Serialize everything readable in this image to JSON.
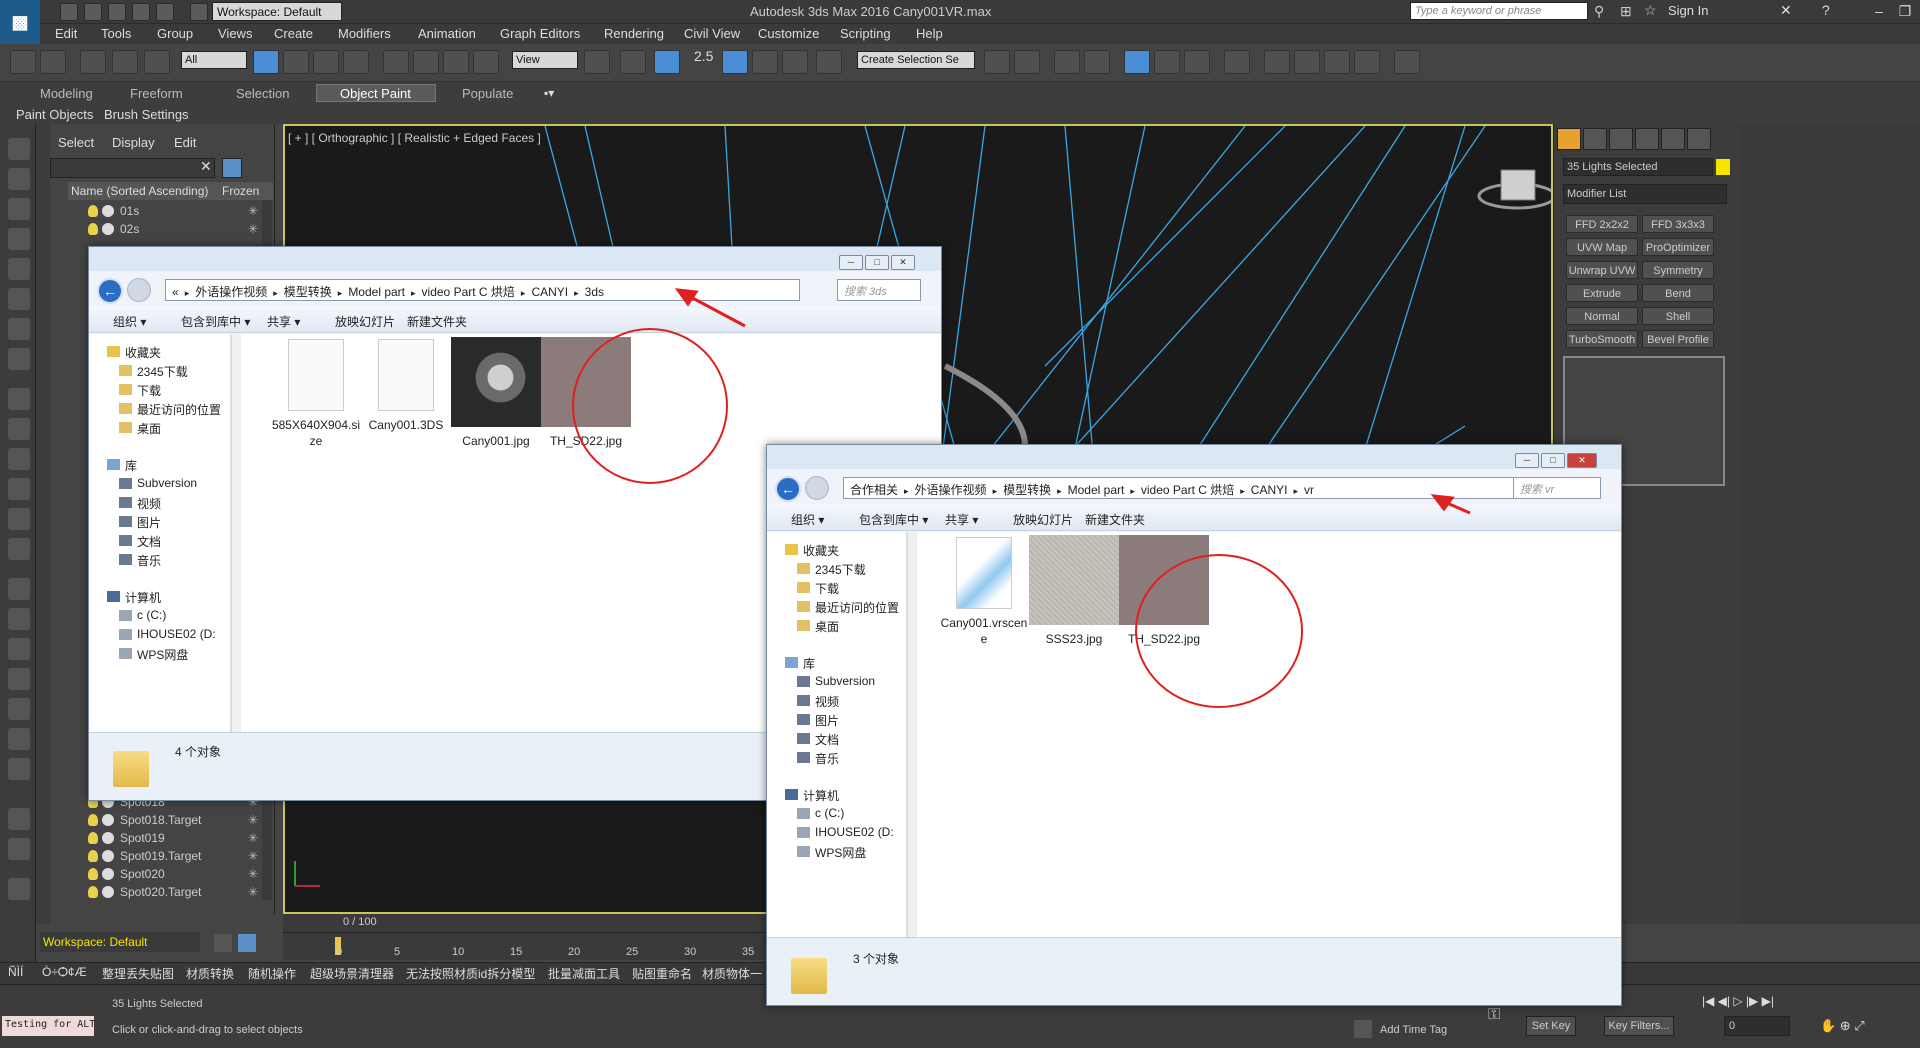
{
  "titlebar": {
    "workspace": "Workspace: Default",
    "app_title": "Autodesk 3ds Max 2016      Cany001VR.max",
    "search_placeholder": "Type a keyword or phrase",
    "sign_in": "Sign In"
  },
  "menu": [
    "Edit",
    "Tools",
    "Group",
    "Views",
    "Create",
    "Modifiers",
    "Animation",
    "Graph Editors",
    "Rendering",
    "Civil View",
    "Customize",
    "Scripting",
    "Help"
  ],
  "toolbar": {
    "filter_select": "All",
    "view_select": "View",
    "selection_set": "Create Selection Se",
    "snap_label": "2.5"
  },
  "ribbon": {
    "tabs": [
      "Modeling",
      "Freeform",
      "Selection",
      "Object Paint",
      "Populate"
    ],
    "active_tab": "Object Paint",
    "sub_items": [
      "Paint Objects",
      "Brush Settings"
    ]
  },
  "scene_explorer": {
    "tabs": [
      "Select",
      "Display",
      "Edit"
    ],
    "header_name": "Name (Sorted Ascending)",
    "header_frozen": "Frozen",
    "rows_top": [
      "01s",
      "02s"
    ],
    "rows_bottom": [
      "Spot018",
      "Spot018.Target",
      "Spot019",
      "Spot019.Target",
      "Spot020",
      "Spot020.Target"
    ]
  },
  "viewport": {
    "label": "[ + ] [ Orthographic ] [ Realistic + Edged Faces ]"
  },
  "command_panel": {
    "selection": "35 Lights Selected",
    "modifier_list": "Modifier List",
    "modifiers": [
      "FFD 2x2x2",
      "FFD 3x3x3",
      "UVW Map",
      "ProOptimizer",
      "Unwrap UVW",
      "Symmetry",
      "Extrude",
      "Bend",
      "Normal",
      "Shell",
      "TurboSmooth",
      "Bevel Profile"
    ]
  },
  "timeline": {
    "frame": "0 / 100",
    "ticks": [
      "0",
      "5",
      "10",
      "15",
      "20",
      "25",
      "30",
      "35"
    ],
    "workspace": "Workspace: Default"
  },
  "plugins": [
    "ÑÌÍ",
    "Ò÷Ѻ¢Æ",
    "整理丢失贴图",
    "材质转换",
    "随机操作",
    "超级场景清理器",
    "无法按照材质id拆分模型",
    "批量减面工具",
    "贴图重命名",
    "材质物体一"
  ],
  "status": {
    "maxscript": "Testing for ALT",
    "line1": "35 Lights Selected",
    "line2": "Click or click-and-drag to select objects",
    "add_time_tag": "Add Time Tag",
    "set_key": "Set Key",
    "key_filters": "Key Filters...",
    "frame_field": "0"
  },
  "window1": {
    "path": [
      "«",
      "外语操作视频",
      "模型转换",
      "Model part",
      "video Part C 烘焙",
      "CANYI",
      "3ds"
    ],
    "search": "搜索 3ds",
    "commands": [
      "组织 ▾",
      "包含到库中 ▾",
      "共享 ▾",
      "放映幻灯片",
      "新建文件夹"
    ],
    "nav": {
      "favorites": "收藏夹",
      "fav_items": [
        "2345下载",
        "下载",
        "最近访问的位置",
        "桌面"
      ],
      "library": "库",
      "lib_items": [
        "Subversion",
        "视频",
        "图片",
        "文档",
        "音乐"
      ],
      "computer": "计算机",
      "comp_items": [
        "c (C:)",
        "IHOUSE02 (D:",
        "WPS网盘"
      ]
    },
    "files": [
      {
        "name": "585X640X904.size",
        "kind": "doc"
      },
      {
        "name": "Cany001.3DS",
        "kind": "doc"
      },
      {
        "name": "Cany001.jpg",
        "kind": "photo"
      },
      {
        "name": "TH_SD22.jpg",
        "kind": "swatch"
      }
    ],
    "status": "4 个对象"
  },
  "window2": {
    "path": [
      "合作相关",
      "外语操作视频",
      "模型转换",
      "Model part",
      "video Part C 烘焙",
      "CANYI",
      "vr"
    ],
    "search": "搜索 vr",
    "commands": [
      "组织 ▾",
      "包含到库中 ▾",
      "共享 ▾",
      "放映幻灯片",
      "新建文件夹"
    ],
    "nav": {
      "favorites": "收藏夹",
      "fav_items": [
        "2345下载",
        "下载",
        "最近访问的位置",
        "桌面"
      ],
      "library": "库",
      "lib_items": [
        "Subversion",
        "视频",
        "图片",
        "文档",
        "音乐"
      ],
      "computer": "计算机",
      "comp_items": [
        "c (C:)",
        "IHOUSE02 (D:",
        "WPS网盘"
      ]
    },
    "files": [
      {
        "name": "Cany001.vrscene",
        "kind": "vrscene"
      },
      {
        "name": "SSS23.jpg",
        "kind": "fabric"
      },
      {
        "name": "TH_SD22.jpg",
        "kind": "swatch"
      }
    ],
    "status": "3 个对象"
  },
  "colors": {
    "swatch": "#8c7b7b",
    "annotation_red": "#e02020",
    "light_lines": "#3aa8e6",
    "viewport_border": "#c8c85a"
  }
}
